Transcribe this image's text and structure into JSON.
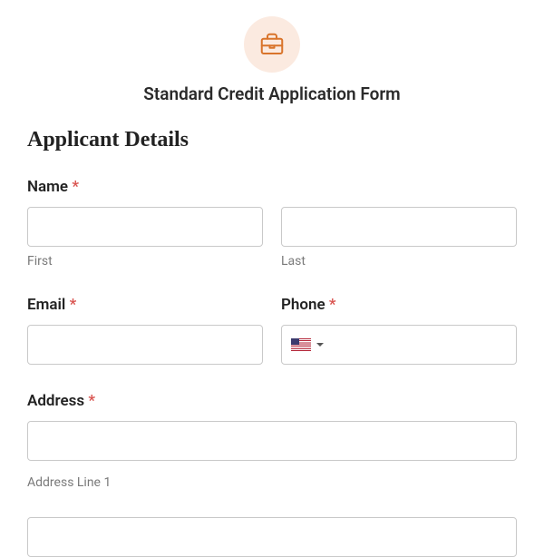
{
  "header": {
    "icon": "briefcase-icon",
    "title": "Standard Credit Application Form"
  },
  "section": {
    "heading": "Applicant Details"
  },
  "fields": {
    "name": {
      "label": "Name",
      "required": "*",
      "first_sublabel": "First",
      "last_sublabel": "Last"
    },
    "email": {
      "label": "Email",
      "required": "*"
    },
    "phone": {
      "label": "Phone",
      "required": "*",
      "country": "US"
    },
    "address": {
      "label": "Address",
      "required": "*",
      "line1_sublabel": "Address Line 1"
    }
  }
}
